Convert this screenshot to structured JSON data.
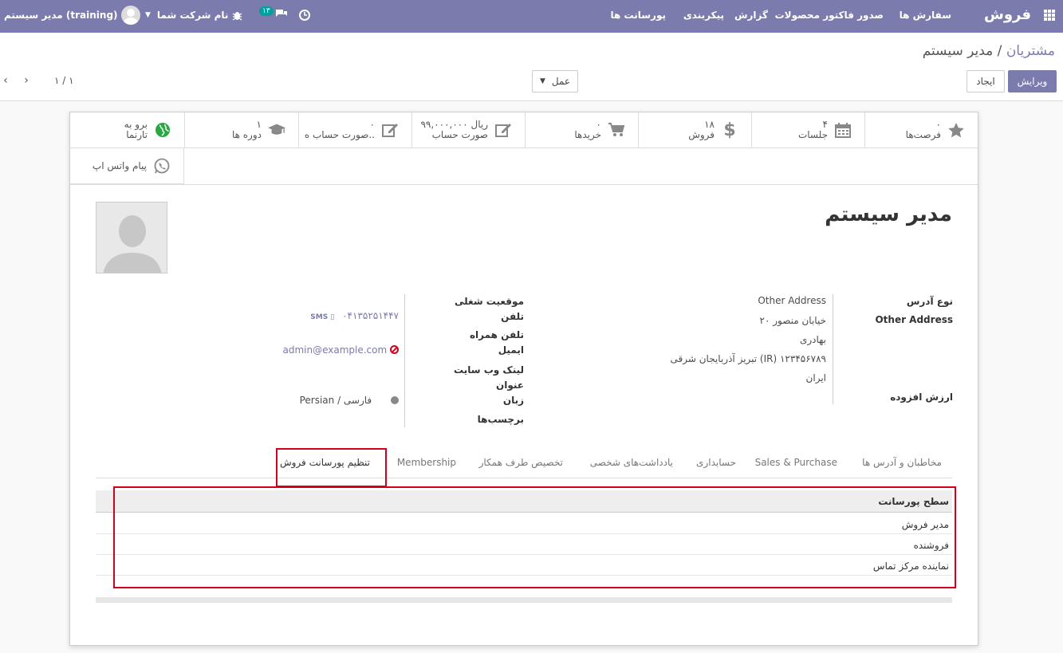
{
  "navbar": {
    "brand": "فروش",
    "menu": [
      "سفارش ها",
      "صدور فاکتور",
      "محصولات",
      "گزارش",
      "پیکربندی",
      "پورسانت ها"
    ],
    "company": "نام شرکت شما",
    "user": "مدیر سیستم (training)",
    "messages_count": "۱۳"
  },
  "breadcrumb": {
    "parent": "مشتریان",
    "sep": " / ",
    "current": "مدیر سیستم"
  },
  "buttons": {
    "edit": "ویرایش",
    "create": "ایجاد",
    "action": "عمل"
  },
  "pager": {
    "value": "۱ / ۱"
  },
  "smart_buttons": [
    {
      "icon": "star-icon",
      "value": "۰",
      "label": "فرصت‌ها"
    },
    {
      "icon": "calendar-icon",
      "value": "۴",
      "label": "جلسات"
    },
    {
      "icon": "dollar-icon",
      "value": "۱۸",
      "label": "فروش"
    },
    {
      "icon": "cart-icon",
      "value": "۰",
      "label": "خریدها"
    },
    {
      "icon": "edit-icon",
      "value": "۹۹,۰۰۰,۰۰۰ ریال",
      "label": "صورت حساب"
    },
    {
      "icon": "edit-icon",
      "value": "۰",
      "label": "صورت حساب ه.."
    },
    {
      "icon": "graduation-cap-icon",
      "value": "۱",
      "label": "دوره ها"
    },
    {
      "icon": "globe-icon",
      "value": "برو به",
      "label": "تارنما"
    },
    {
      "icon": "whatsapp-icon",
      "value": "",
      "label": "پیام واتس اپ"
    }
  ],
  "partner": {
    "name": "مدیر سیستم",
    "labels": {
      "address_type": "نوع آدرس",
      "address_type_value": "Other Address",
      "vat": "ارزش افزوده",
      "function": "موقعیت شغلی",
      "phone": "تلفن",
      "mobile": "تلفن همراه",
      "email": "ایمیل",
      "website": "لینک وب سایت",
      "title": "عنوان",
      "lang": "زبان",
      "tags": "برچسب‌ها"
    },
    "address_lines": [
      "Other Address",
      "۲۰ خیابان منصور",
      "بهادری",
      "تبریز  آذربایجان شرقی (IR)  ۱۲۳۴۵۶۷۸۹",
      "ایران"
    ],
    "mobile": "۰۴۱۳۵۲۵۱۴۴۷",
    "sms": "SMS",
    "email": "admin@example.com",
    "lang": "Persian / فارسی"
  },
  "tabs": [
    "مخاطبان و آدرس ها",
    "Sales & Purchase",
    "حسابداری",
    "یادداشت‌های شخصی",
    "تخصیص طرف همکار",
    "Membership",
    "تنظیم پورسانت فروش"
  ],
  "commission_table": {
    "header": "سطح پورسانت",
    "rows": [
      "مدیر فروش",
      "فروشنده",
      "نماینده مرکز تماس"
    ]
  },
  "colors": {
    "primary": "#7c7bad",
    "highlight": "#d0021b",
    "teal": "#00a09d"
  }
}
